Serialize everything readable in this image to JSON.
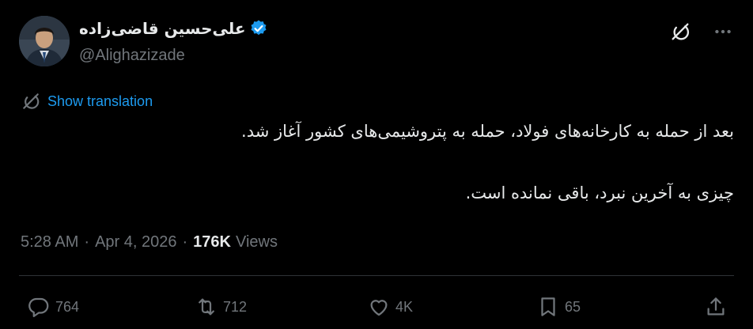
{
  "author": {
    "display_name": "علی‌حسین قاضی‌زاده",
    "handle": "@Alighazizade",
    "verified": true
  },
  "icons": {
    "verified": "verified-badge-icon",
    "grok": "grok-icon",
    "more": "more-dots-icon",
    "translate": "translate-icon",
    "reply": "reply-icon",
    "retweet": "retweet-icon",
    "like": "like-icon",
    "bookmark": "bookmark-icon",
    "share": "share-icon"
  },
  "translation": {
    "label": "Show translation"
  },
  "tweet": {
    "lines": [
      "بعد از حمله به کارخانه‌های فولاد، حمله به پتروشیمی‌های کشور آغاز شد.",
      "چیزی به آخرین نبرد، باقی نمانده است."
    ]
  },
  "meta": {
    "time": "5:28 AM",
    "separator": "·",
    "date": "Apr 4, 2026",
    "views_count": "176K",
    "views_label": "Views"
  },
  "stats": {
    "replies": "764",
    "retweets": "712",
    "likes": "4K",
    "bookmarks": "65"
  },
  "colors": {
    "background": "#000000",
    "text_primary": "#e7e9ea",
    "text_secondary": "#71767b",
    "accent": "#1d9bf0",
    "divider": "#2f3336"
  }
}
